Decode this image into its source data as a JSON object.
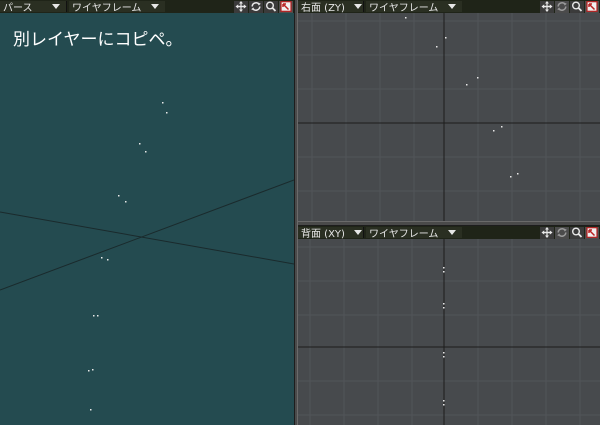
{
  "perspective": {
    "view_label": "パース",
    "mode_label": "ワイヤフレーム",
    "caption": "別レイヤーにコピペ。",
    "bg_color": "#244b50"
  },
  "right_view": {
    "view_label": "右面 (ZY)",
    "mode_label": "ワイヤフレーム",
    "bg_color": "#474a4d"
  },
  "back_view": {
    "view_label": "背面 (XY)",
    "mode_label": "ワイヤフレーム",
    "bg_color": "#474a4d"
  },
  "icons": [
    "move-icon",
    "rotate-icon",
    "zoom-icon",
    "maximize-icon"
  ]
}
